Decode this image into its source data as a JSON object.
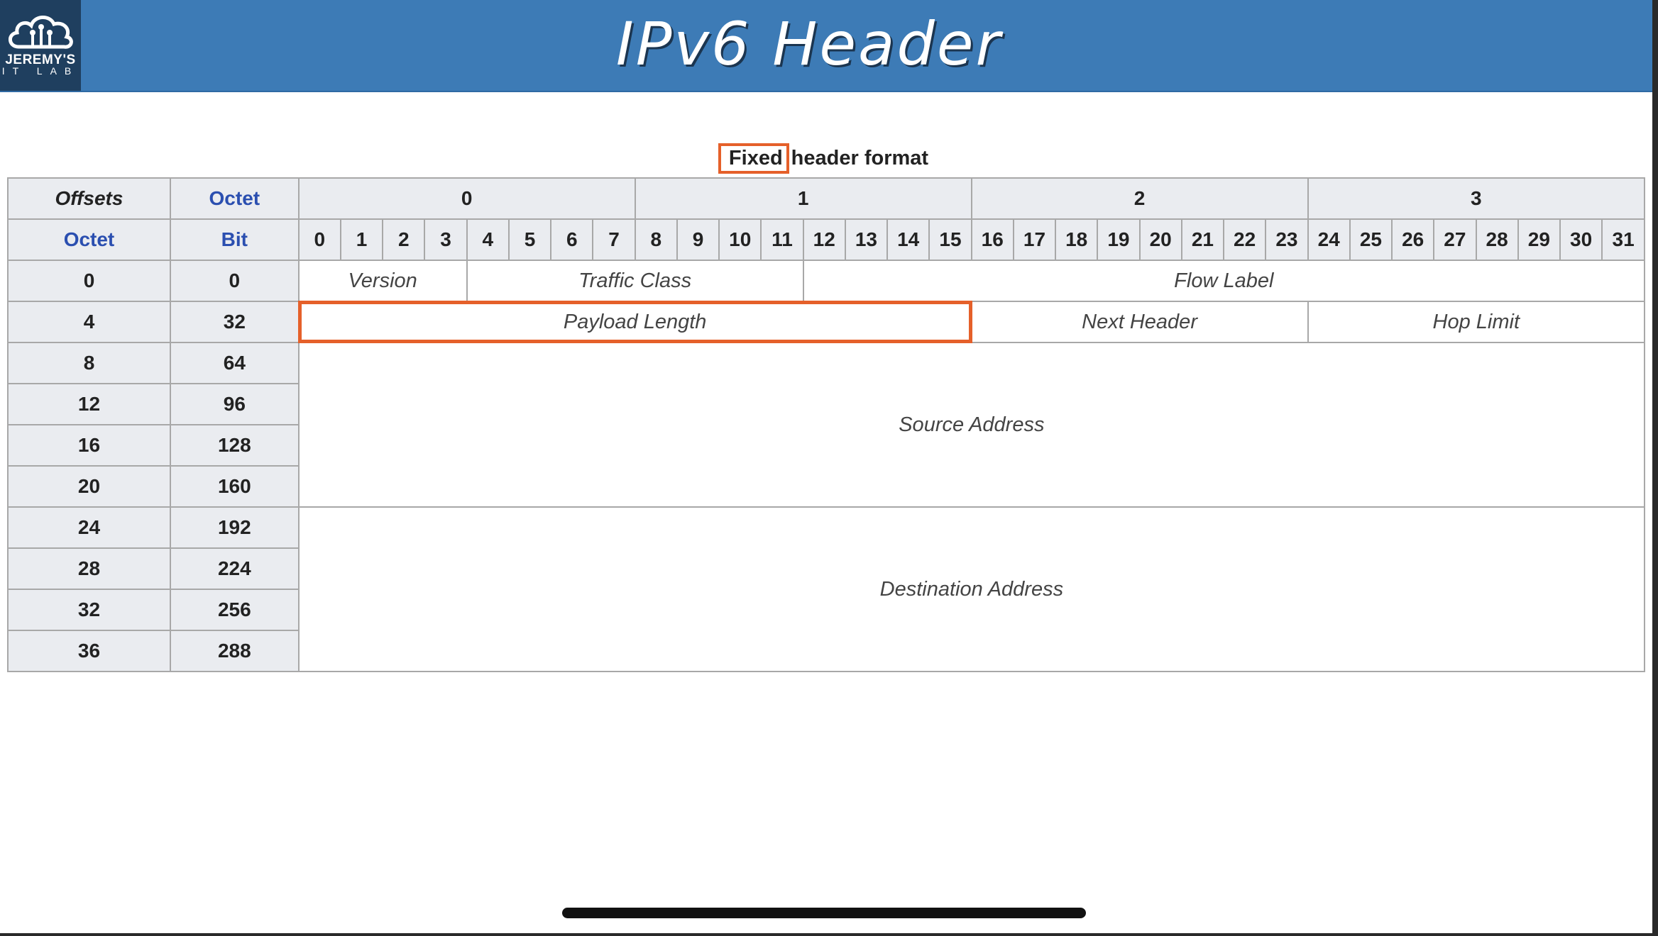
{
  "header": {
    "title": "IPv6 Header",
    "logo_line1": "JEREMY'S",
    "logo_line2": "IT LAB"
  },
  "caption": {
    "highlight": "Fixed",
    "rest": "header format"
  },
  "table": {
    "corner_offsets": "Offsets",
    "corner_octet": "Octet",
    "octet_label": "Octet",
    "bit_label": "Bit",
    "octet_headers": [
      "0",
      "1",
      "2",
      "3"
    ],
    "bits": [
      "0",
      "1",
      "2",
      "3",
      "4",
      "5",
      "6",
      "7",
      "8",
      "9",
      "10",
      "11",
      "12",
      "13",
      "14",
      "15",
      "16",
      "17",
      "18",
      "19",
      "20",
      "21",
      "22",
      "23",
      "24",
      "25",
      "26",
      "27",
      "28",
      "29",
      "30",
      "31"
    ],
    "rows": [
      {
        "octet": "0",
        "bit": "0"
      },
      {
        "octet": "4",
        "bit": "32"
      },
      {
        "octet": "8",
        "bit": "64"
      },
      {
        "octet": "12",
        "bit": "96"
      },
      {
        "octet": "16",
        "bit": "128"
      },
      {
        "octet": "20",
        "bit": "160"
      },
      {
        "octet": "24",
        "bit": "192"
      },
      {
        "octet": "28",
        "bit": "224"
      },
      {
        "octet": "32",
        "bit": "256"
      },
      {
        "octet": "36",
        "bit": "288"
      }
    ],
    "fields": {
      "version": "Version",
      "traffic_class": "Traffic Class",
      "flow_label": "Flow Label",
      "payload_length": "Payload Length",
      "next_header": "Next Header",
      "hop_limit": "Hop Limit",
      "source_address": "Source Address",
      "destination_address": "Destination Address"
    }
  },
  "colors": {
    "banner": "#3d7bb6",
    "highlight": "#e5602a",
    "header_cell": "#eaecf0",
    "label_blue": "#2b4fb0"
  }
}
